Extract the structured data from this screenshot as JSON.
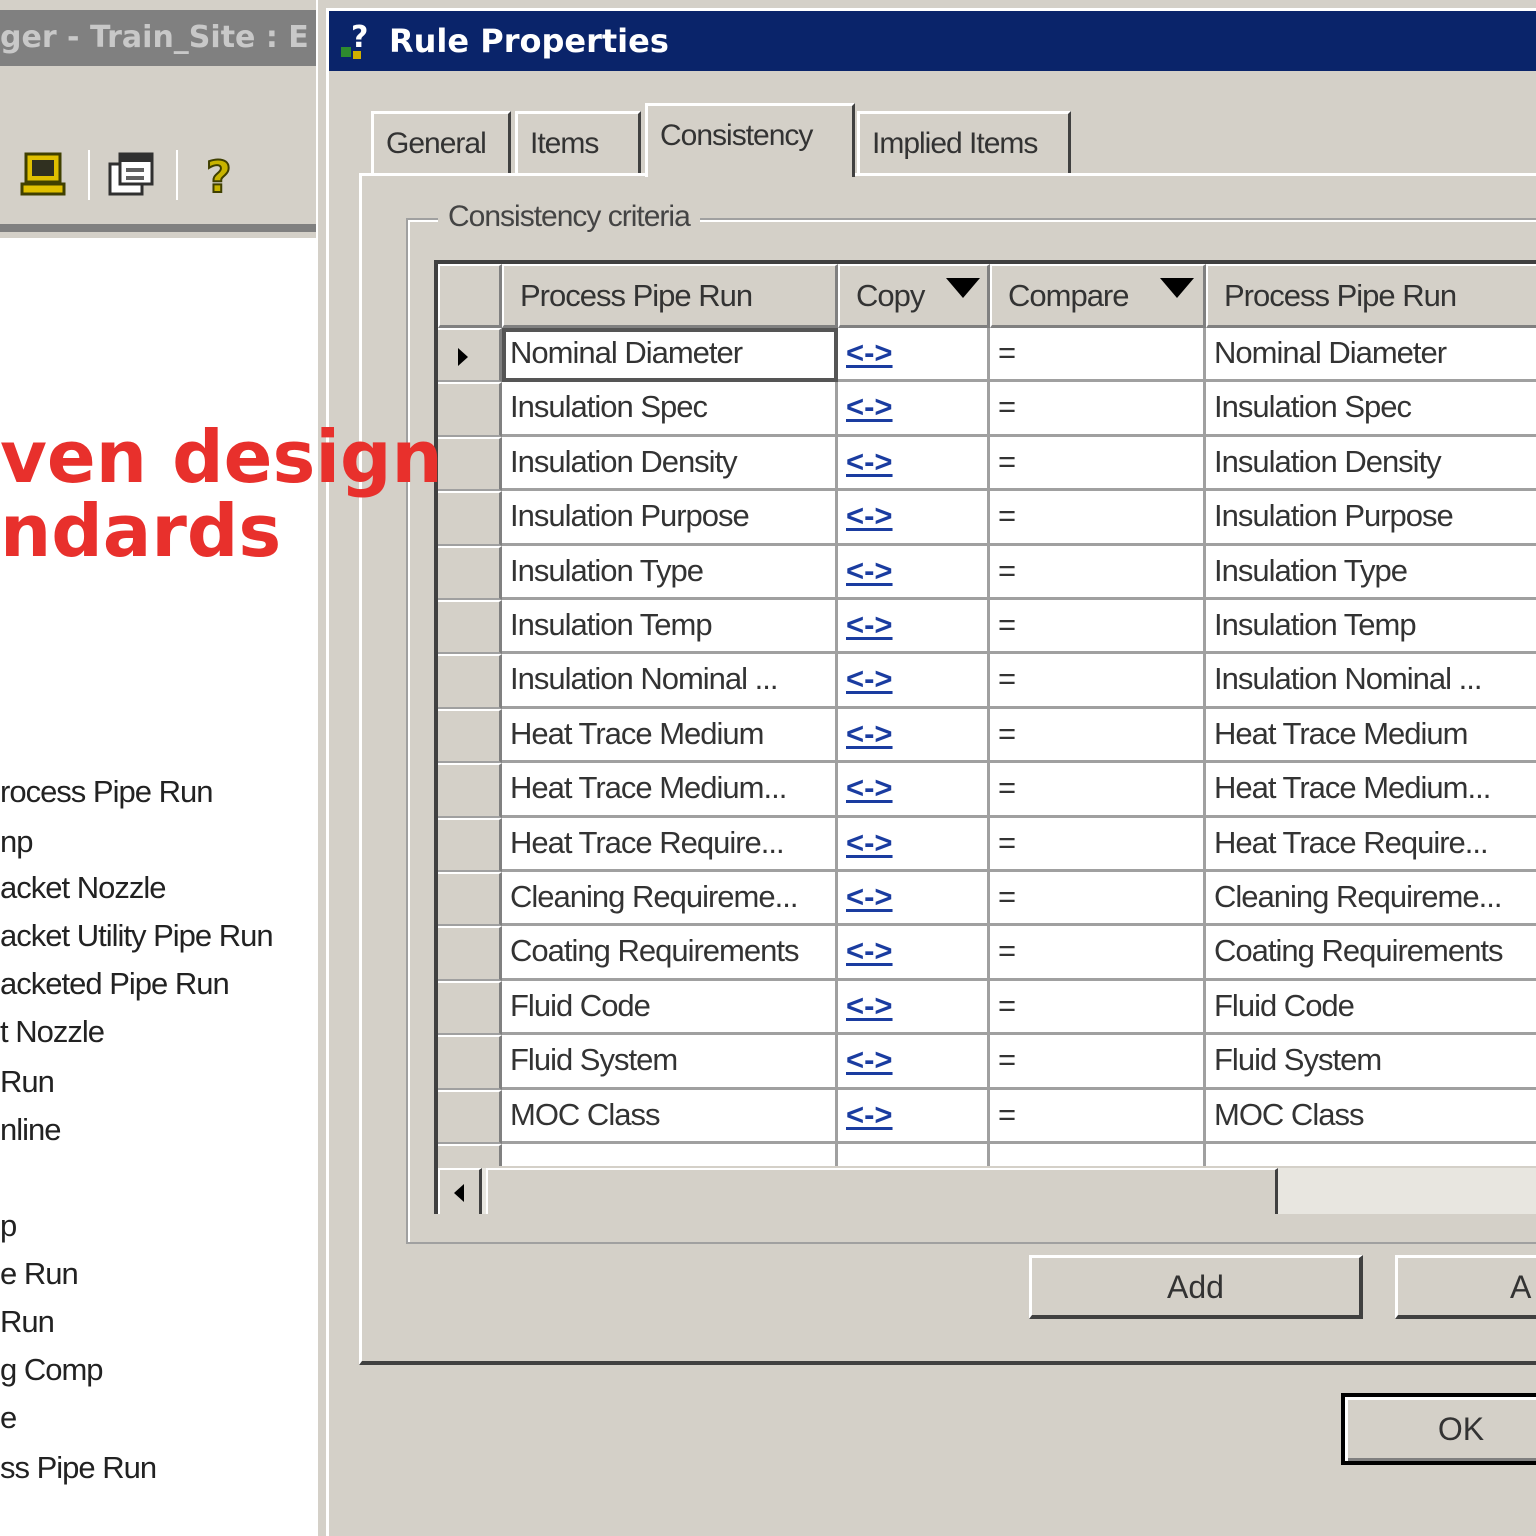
{
  "left_window": {
    "title": "ger - Train_Site : E",
    "tree_items": [
      "rocess Pipe Run",
      "np",
      "acket Nozzle",
      "acket Utility Pipe Run",
      "acketed Pipe Run",
      "t Nozzle",
      "Run",
      "nline",
      "p",
      "e Run",
      " Run",
      "g Comp",
      "e",
      "ss Pipe Run"
    ]
  },
  "promo": {
    "line1": "ven design",
    "line2": "ndards"
  },
  "dialog": {
    "title": "Rule Properties",
    "tabs": [
      "General",
      "Items",
      "Consistency",
      "Implied Items"
    ],
    "active_tab": "Consistency",
    "group_label": "Consistency criteria",
    "grid": {
      "columns": [
        "Process Pipe Run",
        "Copy",
        "Compare",
        "Process Pipe Run"
      ],
      "rows": [
        {
          "left": "Nominal Diameter",
          "copy": "<->",
          "compare": "=",
          "right": "Nominal Diameter"
        },
        {
          "left": "Insulation Spec",
          "copy": "<->",
          "compare": "=",
          "right": "Insulation Spec"
        },
        {
          "left": "Insulation Density",
          "copy": "<->",
          "compare": "=",
          "right": "Insulation Density"
        },
        {
          "left": "Insulation Purpose",
          "copy": "<->",
          "compare": "=",
          "right": "Insulation Purpose"
        },
        {
          "left": "Insulation Type",
          "copy": "<->",
          "compare": "=",
          "right": "Insulation Type"
        },
        {
          "left": "Insulation Temp",
          "copy": "<->",
          "compare": "=",
          "right": "Insulation Temp"
        },
        {
          "left": "Insulation Nominal ...",
          "copy": "<->",
          "compare": "=",
          "right": "Insulation Nominal ..."
        },
        {
          "left": "Heat Trace Medium",
          "copy": "<->",
          "compare": "=",
          "right": "Heat Trace Medium"
        },
        {
          "left": "Heat Trace Medium...",
          "copy": "<->",
          "compare": "=",
          "right": "Heat Trace Medium..."
        },
        {
          "left": "Heat Trace Require...",
          "copy": "<->",
          "compare": "=",
          "right": "Heat Trace Require..."
        },
        {
          "left": "Cleaning Requireme...",
          "copy": "<->",
          "compare": "=",
          "right": "Cleaning Requireme..."
        },
        {
          "left": "Coating Requirements",
          "copy": "<->",
          "compare": "=",
          "right": "Coating Requirements"
        },
        {
          "left": "Fluid Code",
          "copy": "<->",
          "compare": "=",
          "right": "Fluid Code"
        },
        {
          "left": "Fluid System",
          "copy": "<->",
          "compare": "=",
          "right": "Fluid System"
        },
        {
          "left": "MOC Class",
          "copy": "<->",
          "compare": "=",
          "right": "MOC Class"
        }
      ]
    },
    "buttons": {
      "add": "Add",
      "add2": "A",
      "ok": "OK"
    }
  },
  "colors": {
    "titlebar_active": "#0a246a",
    "promo_red": "#e8302c",
    "link_blue": "#1a3ca0"
  }
}
